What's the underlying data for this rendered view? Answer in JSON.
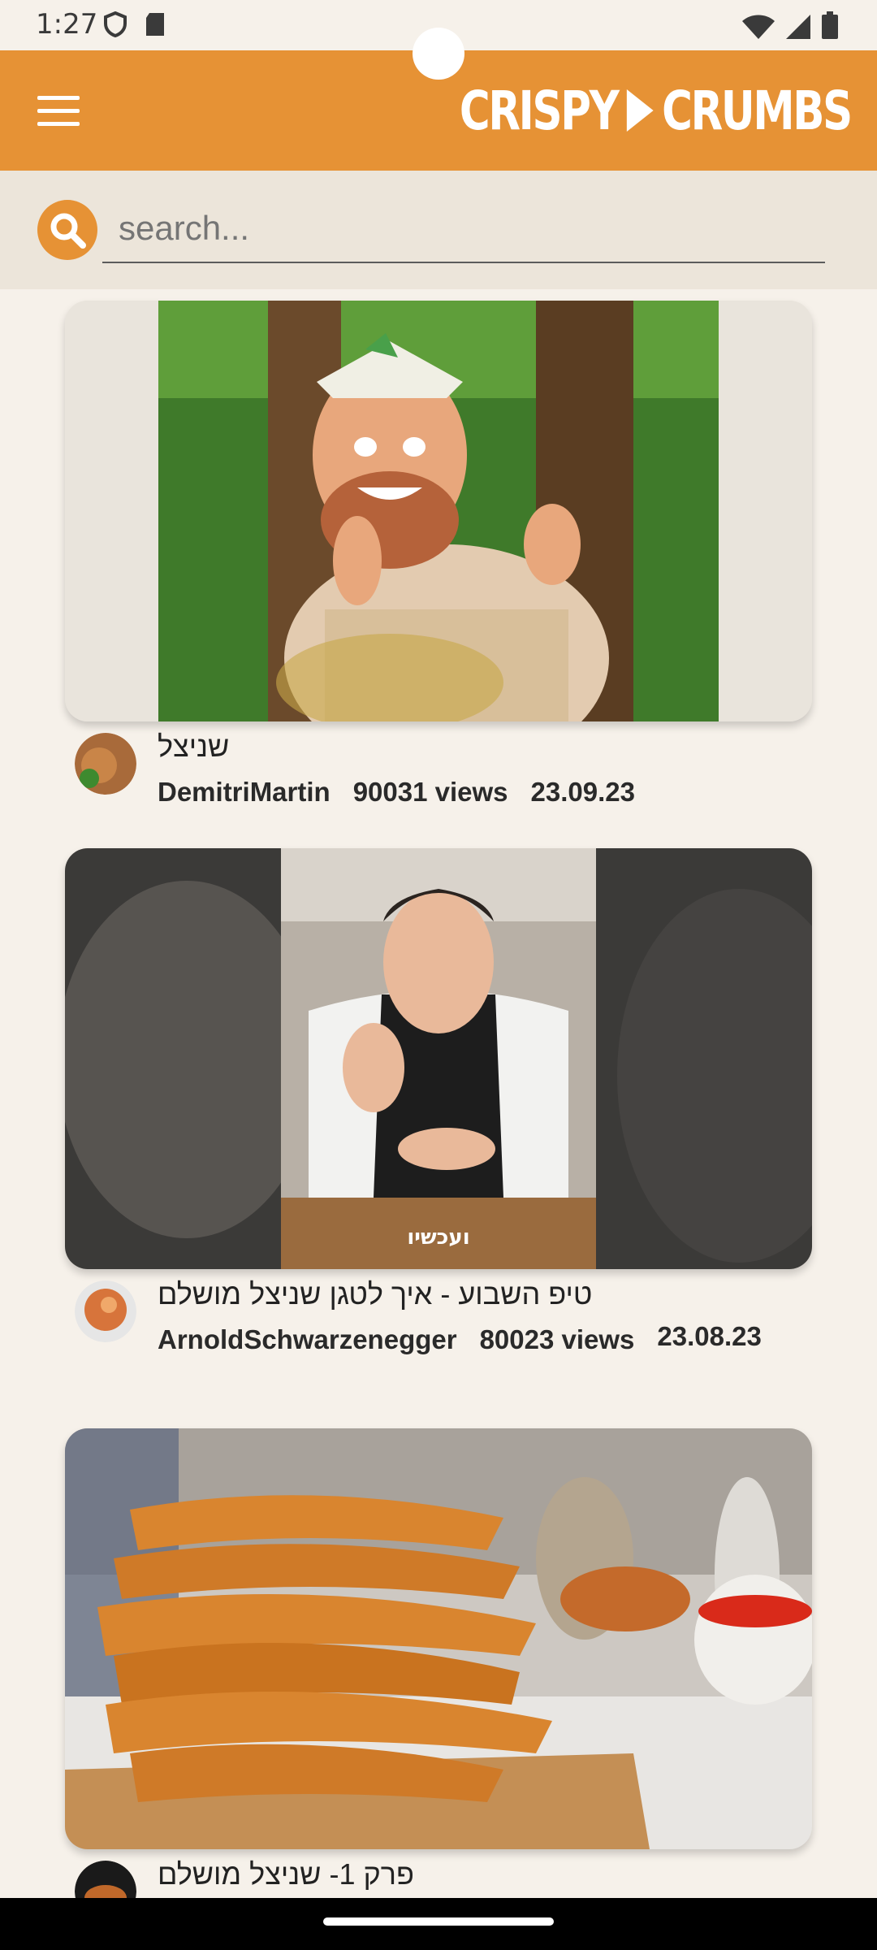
{
  "status": {
    "time": "1:27"
  },
  "app": {
    "brand_left": "CRISPY",
    "brand_right": "CRUMBS",
    "accent": "#e69235"
  },
  "search": {
    "placeholder": "search..."
  },
  "videos": [
    {
      "title": "שניצל",
      "author": "DemitriMartin",
      "views": "90031 views",
      "date": "23.09.23"
    },
    {
      "title": "טיפ השבוע - איך לטגן שניצל מושלם",
      "author": "ArnoldSchwarzenegger",
      "views": "80023 views",
      "date": "23.08.23"
    },
    {
      "title": "פרק 1- שניצל מושלם"
    }
  ],
  "icons": {
    "menu": "hamburger-icon",
    "search": "search-icon",
    "wifi": "wifi-icon",
    "signal": "signal-icon",
    "battery": "battery-icon"
  }
}
